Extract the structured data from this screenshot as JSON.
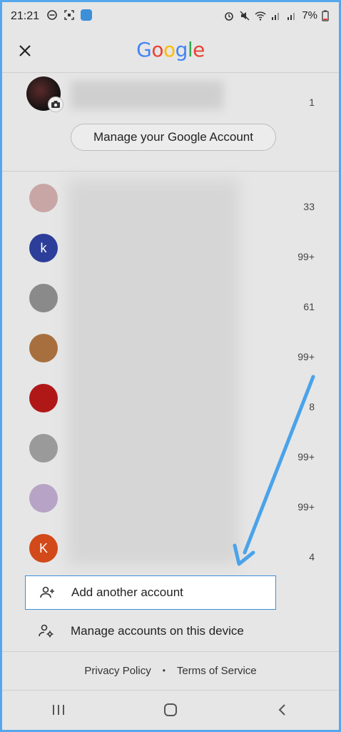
{
  "status_bar": {
    "time": "21:21",
    "battery": "7%"
  },
  "header": {
    "logo_letters": [
      {
        "char": "G",
        "color": "#4285F4"
      },
      {
        "char": "o",
        "color": "#EA4335"
      },
      {
        "char": "o",
        "color": "#FBBC05"
      },
      {
        "char": "g",
        "color": "#4285F4"
      },
      {
        "char": "l",
        "color": "#34A853"
      },
      {
        "char": "e",
        "color": "#EA4335"
      }
    ]
  },
  "primary_account": {
    "count": "1",
    "manage_label": "Manage your Google Account"
  },
  "accounts": [
    {
      "count": "33",
      "avatar_letter": "",
      "avatar_color": "#c9a6a6"
    },
    {
      "count": "99+",
      "avatar_letter": "k",
      "avatar_color": "#2c3e99"
    },
    {
      "count": "61",
      "avatar_letter": "",
      "avatar_color": "#8a8a8a"
    },
    {
      "count": "99+",
      "avatar_letter": "",
      "avatar_color": "#a86f3e"
    },
    {
      "count": "8",
      "avatar_letter": "",
      "avatar_color": "#b01818"
    },
    {
      "count": "99+",
      "avatar_letter": "",
      "avatar_color": "#9a9a9a"
    },
    {
      "count": "99+",
      "avatar_letter": "",
      "avatar_color": "#b7a3c6"
    },
    {
      "count": "4",
      "avatar_letter": "K",
      "avatar_color": "#d2491a"
    }
  ],
  "actions": {
    "add_account": "Add another account",
    "manage_device": "Manage accounts on this device"
  },
  "footer": {
    "privacy": "Privacy Policy",
    "separator": "•",
    "terms": "Terms of Service"
  },
  "colors": {
    "accent": "#3d8fd8",
    "annotation_arrow": "#4aa3ea"
  }
}
